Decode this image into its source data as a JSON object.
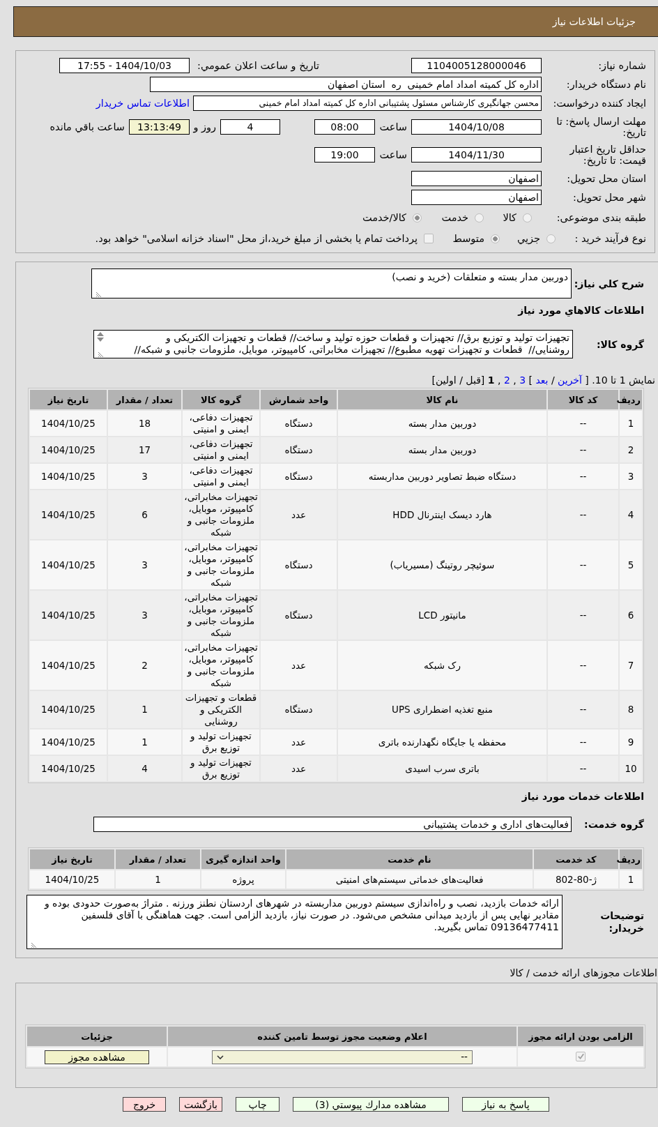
{
  "header": {
    "title": "جزئیات اطلاعات نیاز"
  },
  "request_info": {
    "need_number": {
      "label": "شماره نیاز:",
      "value": "1104005128000046"
    },
    "announcement": {
      "label": "تاریخ و ساعت اعلان عمومي:",
      "value": "1404/10/03 - 17:55"
    },
    "buyer_org": {
      "label": "نام دستگاه خریدار:",
      "value": "اداره کل کمیته امداد امام خمینی  ره  استان اصفهان"
    },
    "requester": {
      "label": "ایجاد کننده درخواست:",
      "value": "محسن جهانگیری کارشناس مسئول پشتیبانی اداره کل کمیته امداد امام خمینی",
      "contact_link": "اطلاعات تماس خریدار"
    },
    "reply_deadline": {
      "label": "مهلت ارسال پاسخ: تا تاریخ:",
      "date": "1404/10/08",
      "time_label": "ساعت",
      "time": "08:00",
      "days": "4",
      "days_label": "روز و",
      "remaining": "13:13:49",
      "remaining_label": "ساعت باقي مانده"
    },
    "price_validity": {
      "label": "حداقل تاريخ اعتبار قیمت: تا تاریخ:",
      "date": "1404/11/30",
      "time_label": "ساعت",
      "time": "19:00"
    },
    "delivery_province": {
      "label": "استان محل تحویل:",
      "value": "اصفهان"
    },
    "delivery_city": {
      "label": "شهر محل تحویل:",
      "value": "اصفهان"
    },
    "subject_category": {
      "label": "طبقه بندی موضوعی:",
      "options": [
        {
          "label": "کالا",
          "selected": false
        },
        {
          "label": "خدمت",
          "selected": false
        },
        {
          "label": "کالا/خدمت",
          "selected": true
        }
      ]
    },
    "purchase_type": {
      "label": "نوع فرآیند خرید :",
      "options": [
        {
          "label": "جزيي",
          "selected": false
        },
        {
          "label": "متوسط",
          "selected": true
        }
      ],
      "treasury": {
        "checked": false,
        "text": "پرداخت تمام یا بخشی از مبلغ خرید،از محل \"اسناد خزانه اسلامی\" خواهد بود."
      }
    }
  },
  "need_details": {
    "summary": {
      "label": "شرح کلي نیاز:",
      "value": "دوربین مدار بسته و متعلقات (خرید و نصب)"
    },
    "goods_heading": "اطلاعات کالاهاي مورد نیاز",
    "goods_group": {
      "label": "گروه کالا:",
      "lines": [
        "تجهیزات تولید و توزیع برق// تجهیزات و قطعات حوزه تولید و ساخت// قطعات و تجهیزات الکتریکی و",
        "روشنایی//  قطعات و تجهیزات تهویه مطبوع// تجهیزات مخابراتی، کامپیوتر، موبایل، ملزومات جانبی و شبکه//"
      ]
    },
    "pagination": {
      "items": [
        {
          "kind": "text",
          "text": "نمایش 1 تا 10. ["
        },
        {
          "kind": "link",
          "text": "آخرین"
        },
        {
          "kind": "text",
          "text": "/"
        },
        {
          "kind": "link",
          "text": "بعد"
        },
        {
          "kind": "text",
          "text": "]"
        },
        {
          "kind": "page",
          "text": "3",
          "selected": false
        },
        {
          "kind": "text",
          "text": ","
        },
        {
          "kind": "page",
          "text": "2",
          "selected": false
        },
        {
          "kind": "text",
          "text": ","
        },
        {
          "kind": "page",
          "text": "1",
          "selected": true
        },
        {
          "kind": "text",
          "text": "[قبل / اولین]"
        }
      ]
    },
    "goods_table": {
      "columns": [
        "ردیف",
        "کد کالا",
        "نام کالا",
        "واحد شمارش",
        "گروه کالا",
        "تعداد / مقدار",
        "تاریخ نیاز"
      ],
      "rows": [
        [
          "1",
          "--",
          "دوربین مدار بسته",
          "دستگاه",
          "تجهیزات دفاعی، ایمنی و امنیتی",
          "18",
          "1404/10/25"
        ],
        [
          "2",
          "--",
          "دوربین مدار بسته",
          "دستگاه",
          "تجهیزات دفاعی، ایمنی و امنیتی",
          "17",
          "1404/10/25"
        ],
        [
          "3",
          "--",
          "دستگاه ضبط تصاویر دوربین مداربسته",
          "دستگاه",
          "تجهیزات دفاعی، ایمنی و امنیتی",
          "3",
          "1404/10/25"
        ],
        [
          "4",
          "--",
          "هارد دیسک اینترنال HDD",
          "عدد",
          "تجهیزات مخابراتی، کامپیوتر، موبایل، ملزومات جانبی و شبکه",
          "6",
          "1404/10/25"
        ],
        [
          "5",
          "--",
          "سوئیچر روتینگ (مسیریاب)",
          "دستگاه",
          "تجهیزات مخابراتی، کامپیوتر، موبایل، ملزومات جانبی و شبکه",
          "3",
          "1404/10/25"
        ],
        [
          "6",
          "--",
          "مانیتور LCD",
          "دستگاه",
          "تجهیزات مخابراتی، کامپیوتر، موبایل، ملزومات جانبی و شبکه",
          "3",
          "1404/10/25"
        ],
        [
          "7",
          "--",
          "رک شبکه",
          "عدد",
          "تجهیزات مخابراتی، کامپیوتر، موبایل، ملزومات جانبی و شبکه",
          "2",
          "1404/10/25"
        ],
        [
          "8",
          "--",
          "منبع تغذیه اضطراری UPS",
          "دستگاه",
          "قطعات و تجهیزات الکتریکی و روشنایی",
          "1",
          "1404/10/25"
        ],
        [
          "9",
          "--",
          "محفظه یا جایگاه نگهدارنده باتری",
          "عدد",
          "تجهیزات تولید و توزیع برق",
          "1",
          "1404/10/25"
        ],
        [
          "10",
          "--",
          "باتری سرب اسیدی",
          "عدد",
          "تجهیزات تولید و توزیع برق",
          "4",
          "1404/10/25"
        ]
      ]
    },
    "services_heading": "اطلاعات خدمات مورد نیاز",
    "service_group": {
      "label": "گروه خدمت:",
      "value": "فعالیت‌های اداری و خدمات پشتیبانی"
    },
    "services_table": {
      "columns": [
        "ردیف",
        "کد خدمت",
        "نام خدمت",
        "واحد اندازه گیری",
        "تعداد / مقدار",
        "تاریخ نیاز"
      ],
      "rows": [
        [
          "1",
          "ژ-80-802",
          "فعالیت‌های خدماتی سیستم‌های امنیتی",
          "پروژه",
          "1",
          "1404/10/25"
        ]
      ]
    },
    "buyer_notes": {
      "label": "توضیحات خریدار:",
      "value": "ارائه خدمات بازدید، نصب و راه‌اندازی سیستم دوربین مداربسته در شهرهای اردستان نطنز ورزنه . متراژ به‌صورت حدودی بوده و مقادیر نهایی پس از بازدید میدانی مشخص می‌شود. در صورت نیاز، بازدید الزامی است. جهت هماهنگی با آقای فلسفین 09136477411 تماس بگیرید."
    }
  },
  "licenses": {
    "title": "اطلاعات مجوزهای ارائه خدمت / کالا",
    "columns": [
      "الزامی بودن ارائه مجوز",
      "اعلام وضعیت مجوز توسط تامین کننده",
      "جزئیات"
    ],
    "rows": [
      {
        "required": true,
        "status": "--",
        "action": "مشاهده مجوز"
      }
    ]
  },
  "actions": [
    {
      "label": "پاسخ به نیاز",
      "kind": "confirm"
    },
    {
      "label": "مشاهده مدارك پيوستي (3)",
      "kind": "confirm"
    },
    {
      "label": "چاپ",
      "kind": "confirm"
    },
    {
      "label": "بازگشت",
      "kind": "cancel"
    },
    {
      "label": "خروج",
      "kind": "cancel"
    }
  ]
}
